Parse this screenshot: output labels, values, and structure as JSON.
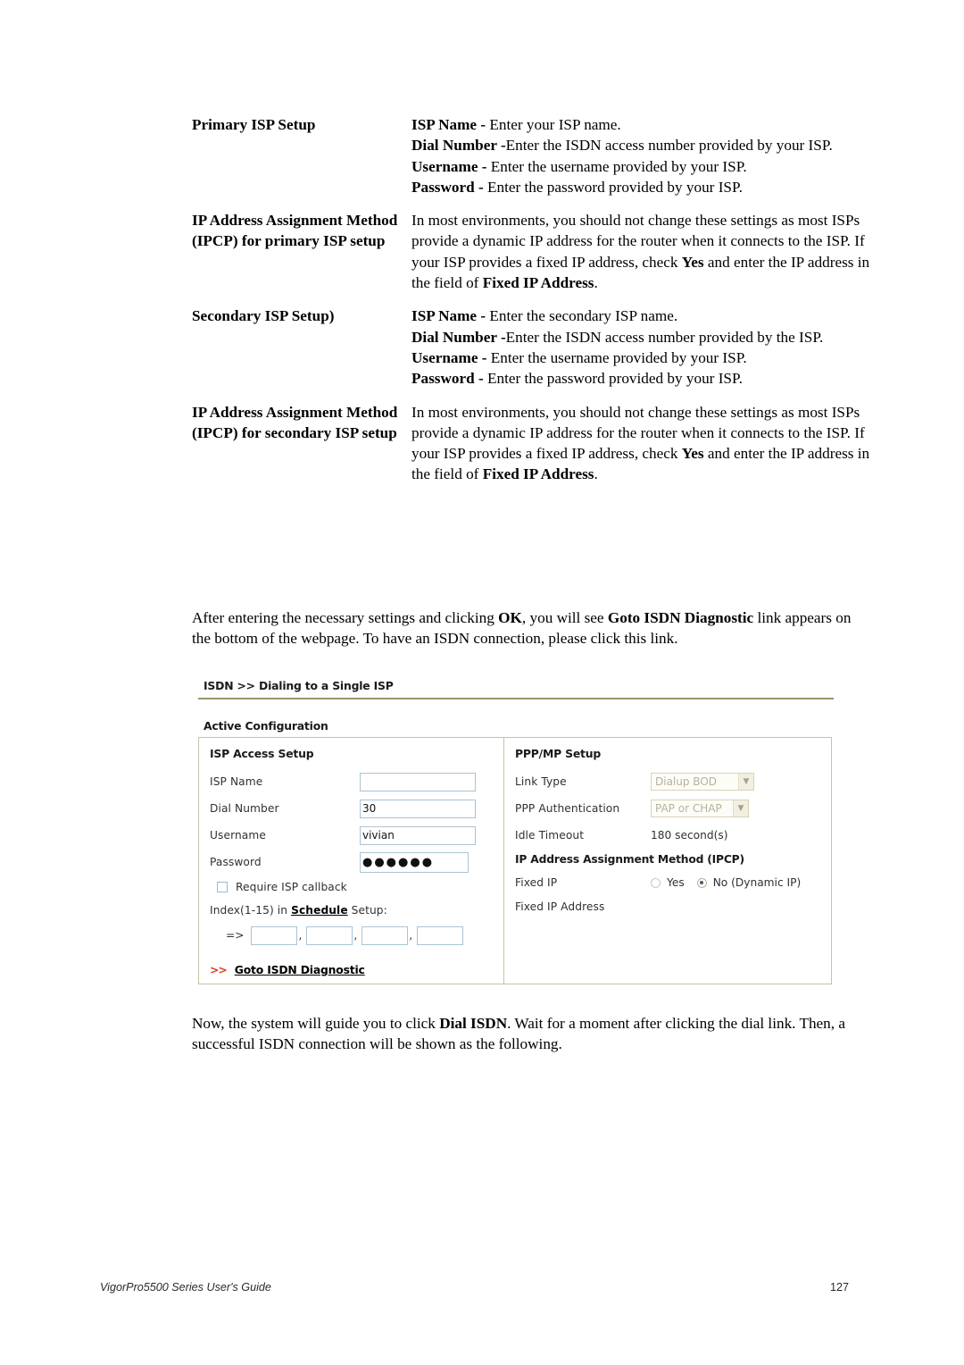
{
  "definitions": [
    {
      "term": "Primary ISP Setup",
      "lines": [
        {
          "bold": "ISP Name - ",
          "text": "Enter your ISP name."
        },
        {
          "bold": "Dial Number -",
          "text": "Enter the ISDN access number provided by your ISP."
        },
        {
          "bold": "Username - ",
          "text": "Enter the username provided by your ISP."
        },
        {
          "bold": "Password - ",
          "text": "Enter the password provided by your ISP."
        }
      ]
    },
    {
      "term": "IP Address Assignment Method (IPCP) for primary ISP setup",
      "paragraph_parts": [
        {
          "text": "In most environments, you should not change these settings as most ISPs provide a dynamic IP address for the router when it connects to the ISP. If your ISP provides a fixed IP address, check ",
          "bold": false
        },
        {
          "text": "Yes",
          "bold": true
        },
        {
          "text": " and enter the IP address in the field of ",
          "bold": false
        },
        {
          "text": "Fixed IP Address",
          "bold": true
        },
        {
          "text": ".",
          "bold": false
        }
      ]
    },
    {
      "term": "Secondary ISP Setup)",
      "lines": [
        {
          "bold": "ISP Name - ",
          "text": "Enter the secondary ISP name."
        },
        {
          "bold": "Dial Number -",
          "text": "Enter the ISDN access number provided by the ISP."
        },
        {
          "bold": "Username - ",
          "text": "Enter the username provided by your ISP."
        },
        {
          "bold": "Password - ",
          "text": "Enter the password provided by your ISP."
        }
      ]
    },
    {
      "term": "IP Address Assignment Method (IPCP) for secondary ISP setup",
      "paragraph_parts": [
        {
          "text": "In most environments, you should not change these settings as most ISPs provide a dynamic IP address for the router when it connects to the ISP. If your ISP provides a fixed IP address, check ",
          "bold": false
        },
        {
          "text": "Yes",
          "bold": true
        },
        {
          "text": " and enter the IP address in the field of ",
          "bold": false
        },
        {
          "text": "Fixed IP Address",
          "bold": true
        },
        {
          "text": ".",
          "bold": false
        }
      ]
    }
  ],
  "paragraph_ok": {
    "parts": [
      {
        "text": "After entering the necessary settings and clicking ",
        "bold": false
      },
      {
        "text": "OK",
        "bold": true
      },
      {
        "text": ", you will see ",
        "bold": false
      },
      {
        "text": "Goto ISDN Diagnostic",
        "bold": true
      },
      {
        "text": " link appears on the bottom of the webpage. To have an ISDN connection, please click this link.",
        "bold": false
      }
    ]
  },
  "paragraph_dial": {
    "parts": [
      {
        "text": "Now, the system will guide you to click ",
        "bold": false
      },
      {
        "text": "Dial ISDN",
        "bold": true
      },
      {
        "text": ". Wait for a moment after clicking the dial link. Then, a successful ISDN connection will be shown as the following.",
        "bold": false
      }
    ]
  },
  "screenshot": {
    "title": "ISDN >> Dialing to a Single ISP",
    "subtitle": "Active Configuration",
    "isp_access": {
      "heading": "ISP Access Setup",
      "isp_name_label": "ISP Name",
      "isp_name_value": "",
      "dial_number_label": "Dial Number",
      "dial_number_value": "30",
      "username_label": "Username",
      "username_value": "vivian",
      "password_label": "Password",
      "password_value": "●●●●●●",
      "callback_label": "Require ISP callback",
      "callback_checked": false,
      "schedule_prefix": "Index(1-15) in ",
      "schedule_link": "Schedule",
      "schedule_suffix": " Setup:",
      "arrow": "=>",
      "comma": ",",
      "schedule_values": [
        "",
        "",
        "",
        ""
      ],
      "goto_chevron": ">>",
      "goto_link": "Goto ISDN Diagnostic",
      "goto_chevron_color": "#e03a1a"
    },
    "ppp_mp": {
      "heading": "PPP/MP Setup",
      "link_type_label": "Link Type",
      "link_type_value": "Dialup BOD",
      "ppp_auth_label": "PPP Authentication",
      "ppp_auth_value": "PAP or CHAP",
      "idle_timeout_label": "Idle Timeout",
      "idle_timeout_value": "180 second(s)",
      "ipcp_heading": "IP Address Assignment Method (IPCP)",
      "fixed_ip_label": "Fixed IP",
      "fixed_ip_yes": "Yes",
      "fixed_ip_no": "No (Dynamic IP)",
      "fixed_ip_selected": "No (Dynamic IP)",
      "fixed_ip_address_label": "Fixed IP Address",
      "fixed_ip_address_value": ""
    }
  },
  "footer": {
    "left": "VigorPro5500 Series User's Guide",
    "page_number": "127"
  }
}
